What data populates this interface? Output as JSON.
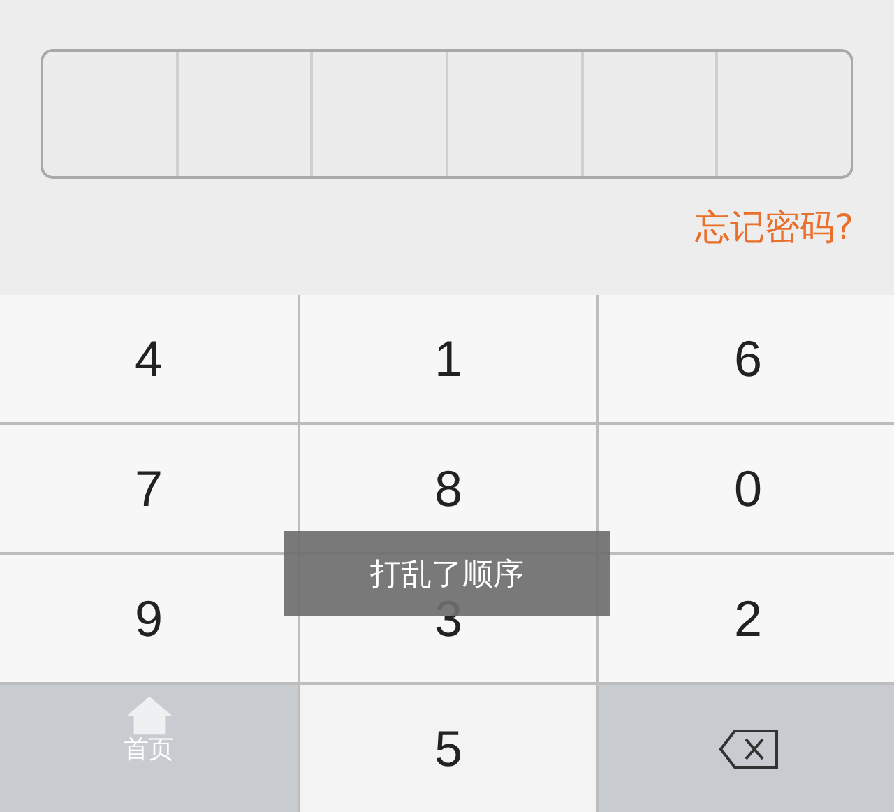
{
  "pin": {
    "cells": [
      "",
      "",
      "",
      "",
      "",
      ""
    ]
  },
  "forgot_link": "忘记密码?",
  "keys": [
    {
      "kind": "digit",
      "label": "4"
    },
    {
      "kind": "digit",
      "label": "1"
    },
    {
      "kind": "digit",
      "label": "6"
    },
    {
      "kind": "digit",
      "label": "7"
    },
    {
      "kind": "digit",
      "label": "8"
    },
    {
      "kind": "digit",
      "label": "0"
    },
    {
      "kind": "digit",
      "label": "9"
    },
    {
      "kind": "digit",
      "label": "3"
    },
    {
      "kind": "digit",
      "label": "2"
    },
    {
      "kind": "home",
      "label": "首页"
    },
    {
      "kind": "digit",
      "label": "5"
    },
    {
      "kind": "delete"
    }
  ],
  "toast": "打乱了顺序"
}
